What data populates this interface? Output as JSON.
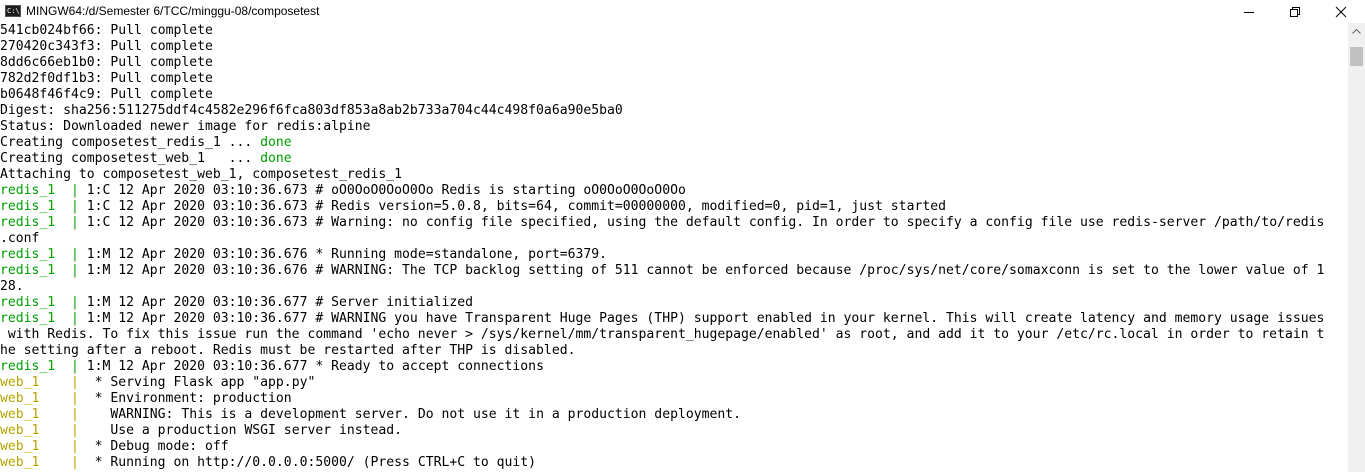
{
  "window": {
    "title": "MINGW64:/d/Semester 6/TCC/minggu-08/composetest",
    "icon_name": "terminal-app-icon",
    "icon_text": "C:\\"
  },
  "controls": {
    "minimize": "minimize-icon",
    "maximize": "restore-icon",
    "close": "close-icon"
  },
  "colors": {
    "background": "#ffffff",
    "text": "#000000",
    "done_green": "#00a000",
    "redis_prefix": "#00a000",
    "web_prefix": "#b6a300"
  },
  "terminal": {
    "pull_lines": [
      {
        "id": "541cb024bf66",
        "status": "Pull complete"
      },
      {
        "id": "270420c343f3",
        "status": "Pull complete"
      },
      {
        "id": "8dd6c66eb1b0",
        "status": "Pull complete"
      },
      {
        "id": "782d2f0df1b3",
        "status": "Pull complete"
      },
      {
        "id": "b0648f46f4c9",
        "status": "Pull complete"
      }
    ],
    "digest": "Digest: sha256:511275ddf4c4582e296f6fca803df853a8ab2b733a704c44c498f0a6a90e5ba0",
    "status": "Status: Downloaded newer image for redis:alpine",
    "creating": [
      {
        "text": "Creating composetest_redis_1 ... ",
        "result": "done"
      },
      {
        "text": "Creating composetest_web_1   ... ",
        "result": "done"
      }
    ],
    "attaching": "Attaching to composetest_web_1, composetest_redis_1",
    "redis_prefix": "redis_1  ",
    "web_prefix": "web_1    ",
    "log_lines": [
      {
        "service": "redis",
        "text": "| 1:C 12 Apr 2020 03:10:36.673 # oO0OoO0OoO0Oo Redis is starting oO0OoO0OoO0Oo"
      },
      {
        "service": "redis",
        "text": "| 1:C 12 Apr 2020 03:10:36.673 # Redis version=5.0.8, bits=64, commit=00000000, modified=0, pid=1, just started"
      },
      {
        "service": "redis",
        "text": "| 1:C 12 Apr 2020 03:10:36.673 # Warning: no config file specified, using the default config. In order to specify a config file use redis-server /path/to/redis"
      },
      {
        "service": "none",
        "text": ".conf"
      },
      {
        "service": "redis",
        "text": "| 1:M 12 Apr 2020 03:10:36.676 * Running mode=standalone, port=6379."
      },
      {
        "service": "redis",
        "text": "| 1:M 12 Apr 2020 03:10:36.676 # WARNING: The TCP backlog setting of 511 cannot be enforced because /proc/sys/net/core/somaxconn is set to the lower value of 1"
      },
      {
        "service": "none",
        "text": "28."
      },
      {
        "service": "redis",
        "text": "| 1:M 12 Apr 2020 03:10:36.677 # Server initialized"
      },
      {
        "service": "redis",
        "text": "| 1:M 12 Apr 2020 03:10:36.677 # WARNING you have Transparent Huge Pages (THP) support enabled in your kernel. This will create latency and memory usage issues"
      },
      {
        "service": "none",
        "text": " with Redis. To fix this issue run the command 'echo never > /sys/kernel/mm/transparent_hugepage/enabled' as root, and add it to your /etc/rc.local in order to retain t"
      },
      {
        "service": "none",
        "text": "he setting after a reboot. Redis must be restarted after THP is disabled."
      },
      {
        "service": "redis",
        "text": "| 1:M 12 Apr 2020 03:10:36.677 * Ready to accept connections"
      },
      {
        "service": "web",
        "text": "|  * Serving Flask app \"app.py\""
      },
      {
        "service": "web",
        "text": "|  * Environment: production"
      },
      {
        "service": "web",
        "text": "|    WARNING: This is a development server. Do not use it in a production deployment."
      },
      {
        "service": "web",
        "text": "|    Use a production WSGI server instead."
      },
      {
        "service": "web",
        "text": "|  * Debug mode: off"
      },
      {
        "service": "web",
        "text": "|  * Running on http://0.0.0.0:5000/ (Press CTRL+C to quit)"
      }
    ]
  },
  "scrollbar": {
    "up_arrow": "scroll-up-arrow-icon",
    "position": 1.0
  }
}
